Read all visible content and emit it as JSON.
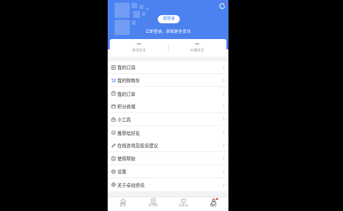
{
  "header": {
    "login_button": "请登录",
    "login_subtitle": "立即登录，获取更多资讯",
    "bg_color": "#4b82f0"
  },
  "stats": [
    {
      "value": "--",
      "label": "资讯关注"
    },
    {
      "value": "--",
      "label": "价格关注"
    }
  ],
  "menu_groups": [
    {
      "items": [
        {
          "label": "我的订阅",
          "icon": "subscription-icon"
        },
        {
          "label": "我的购物车",
          "icon": "cart-icon"
        },
        {
          "label": "我的订单",
          "icon": "order-icon"
        }
      ]
    },
    {
      "items": [
        {
          "label": "积分商城",
          "icon": "points-mall-icon"
        },
        {
          "label": "小工具",
          "icon": "tools-icon"
        },
        {
          "label": "推荐给好友",
          "icon": "recommend-icon"
        }
      ]
    },
    {
      "items": [
        {
          "label": "在线咨询及投诉建议",
          "icon": "feedback-icon"
        },
        {
          "label": "使用帮助",
          "icon": "help-icon"
        },
        {
          "label": "设置",
          "icon": "settings-icon"
        },
        {
          "label": "关于卓创资讯",
          "icon": "about-icon"
        }
      ]
    }
  ],
  "tabbar": [
    {
      "label": "首页",
      "icon": "home-icon",
      "active": false
    },
    {
      "label": "已订阅",
      "icon": "subscribed-icon",
      "active": false
    },
    {
      "label": "已关注",
      "icon": "heart-icon",
      "active": false
    },
    {
      "label": "我的",
      "icon": "profile-icon",
      "active": true
    }
  ]
}
